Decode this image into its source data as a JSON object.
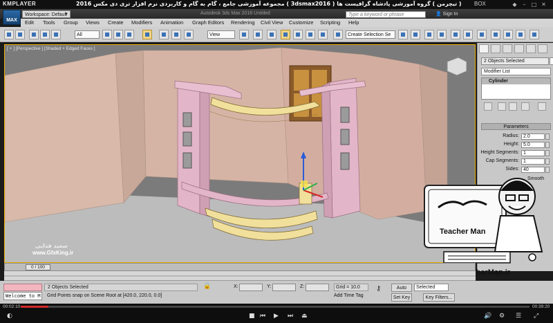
{
  "player": {
    "logo": "KMPLAYER",
    "title": "مجموعه آموزشی جامع ، گام به گام و کاربردی نرم افزار تری دی مکس 2016 ( 3dsmax2016 )   مدرس : سعید فدایی ( تیچرمن ) گروه آموزشی پادشاه گرافیست ها",
    "box_label": "BOX",
    "current_time": "00:02:10",
    "total_time": "00:39:20",
    "progress": 0.055
  },
  "app": {
    "logo": "MAX",
    "workspace_label": "Workspace: Default",
    "title": "Autodesk 3ds Max 2016     Untitled",
    "search_placeholder": "Type a keyword or phrase",
    "sign_in": "Sign In"
  },
  "menu": [
    "Edit",
    "Tools",
    "Group",
    "Views",
    "Create",
    "Modifiers",
    "Animation",
    "Graph Editors",
    "Rendering",
    "Civil View",
    "Customize",
    "Scripting",
    "Help"
  ],
  "toolbar": {
    "filter_value": "All",
    "refcoord_value": "View",
    "selection_set_placeholder": "Create Selection Se"
  },
  "viewport": {
    "label": "[ + ] [Perspective ] [Shaded + Edged Faces ]"
  },
  "watermark": {
    "gfx_name": "سعید فدایی",
    "gfx_url": "www.GfxKing.ir",
    "teacher_url": "www.TeacherMan.ir",
    "teacher_name": "Teacher Man"
  },
  "command_panel": {
    "selection_name": "2 Objects Selected",
    "modifier_list": "Modifier List",
    "stack_item": "Cylinder",
    "parameters_header": "Parameters",
    "parameters": [
      {
        "label": "Radius:",
        "value": "2.0"
      },
      {
        "label": "Height:",
        "value": "5.0"
      },
      {
        "label": "Height Segments:",
        "value": "1"
      },
      {
        "label": "Cap Segments:",
        "value": "1"
      },
      {
        "label": "Sides:",
        "value": "40"
      }
    ],
    "smooth_label": "Smooth"
  },
  "timeline": {
    "frame_display": "0 / 100"
  },
  "status": {
    "maxscript_text": "Welcome to M",
    "selection_text": "2 Objects Selected",
    "prompt_text": "Grid Points snap on Scene Root at [420.0, 220.0, 0.0]",
    "x_label": "X:",
    "y_label": "Y:",
    "z_label": "Z:",
    "grid_text": "Grid = 10.0",
    "add_time_tag": "Add Time Tag",
    "auto_key": "Auto Key",
    "set_key": "Set Key",
    "key_mode": "Selected",
    "key_filters": "Key Filters..."
  },
  "colors": {
    "viewport_bg": "#7b7b7b",
    "active_border": "#f0b000",
    "walls": "#d8b9aa",
    "cabinet": "#e3b5c8",
    "shelf": "#f1df9c",
    "brand_red": "#cf2a2a"
  }
}
